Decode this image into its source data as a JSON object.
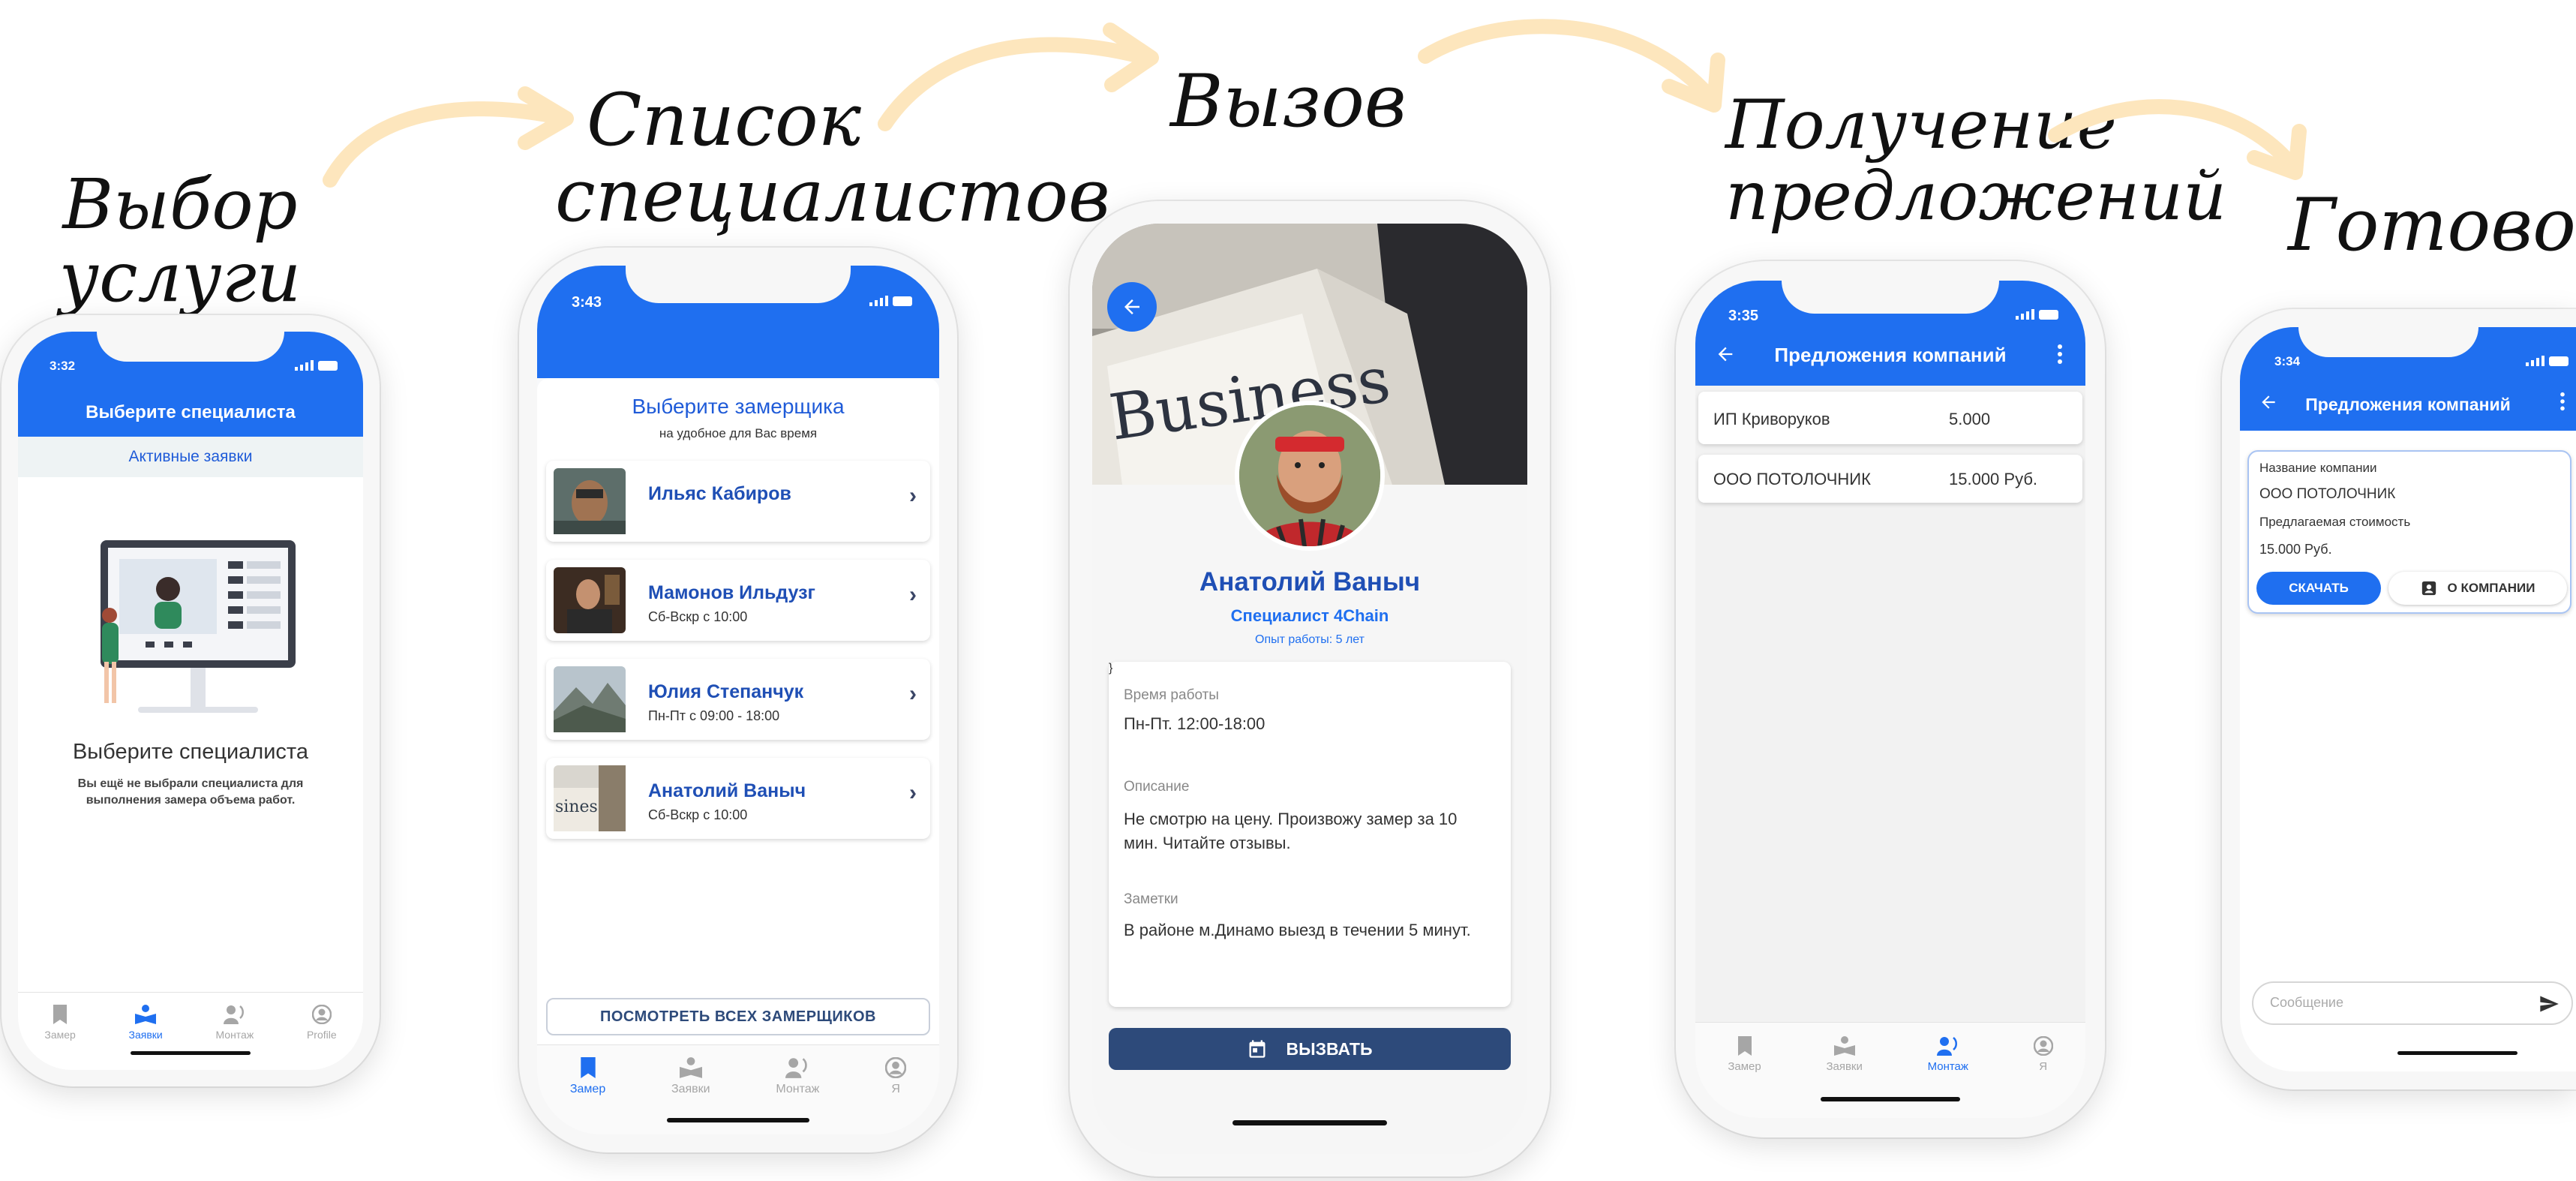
{
  "headings": {
    "step1": "Выбор услуги",
    "step2_line1": "Список",
    "step2_line2": "специалистов",
    "step3": "Вызов",
    "step4_line1": "Получение",
    "step4_line2": "предложений",
    "step5": "Готово!"
  },
  "phone1": {
    "time": "3:32",
    "title": "Выберите специалиста",
    "tab_active_requests": "Активные заявки",
    "empty_title": "Выберите специалиста",
    "empty_text": "Вы ещё не выбрали специалиста для выполнения замера объема работ.",
    "tabs": [
      "Замер",
      "Заявки",
      "Монтаж",
      "Profile"
    ]
  },
  "phone2": {
    "time": "3:43",
    "heading": "Выберите замерщика",
    "subheading": "на удобное для Вас время",
    "specialists": [
      {
        "name": "Ильяс Кабиров",
        "schedule": ""
      },
      {
        "name": "Мамонов Ильдузг",
        "schedule": "Сб-Вскр с 10:00"
      },
      {
        "name": "Юлия Степанчук",
        "schedule": "Пн-Пт с 09:00 - 18:00"
      },
      {
        "name": "Анатолий Ваныч",
        "schedule": "Сб-Вскр с 10:00"
      }
    ],
    "view_all": "ПОСМОТРЕТЬ ВСЕХ ЗАМЕРЩИКОВ",
    "tabs": [
      "Замер",
      "Заявки",
      "Монтаж",
      "Я"
    ]
  },
  "phone3": {
    "cover_text": "Business",
    "name": "Анатолий Ваныч",
    "role": "Специалист 4Chain",
    "experience": "Опыт работы: 5 лет",
    "work_time_label": "Время работы",
    "work_time_value": "Пн-Пт. 12:00-18:00",
    "description_label": "Описание",
    "description_value": "Не смотрю на цену. Произвожу замер за 10 мин. Читайте отзывы.",
    "notes_label": "Заметки",
    "notes_value": "В районе м.Динамо выезд в течении 5 минут.",
    "call_button": "ВЫЗВАТЬ"
  },
  "phone4": {
    "time": "3:35",
    "title": "Предложения компаний",
    "offers": [
      {
        "company": "ИП Криворуков",
        "price": "5.000"
      },
      {
        "company": "ООО ПОТОЛОЧНИК",
        "price": "15.000 Руб."
      }
    ],
    "tabs": [
      "Замер",
      "Заявки",
      "Монтаж",
      "Я"
    ]
  },
  "phone5": {
    "time": "3:34",
    "title": "Предложения компаний",
    "company_label": "Название компании",
    "company_value": "ООО ПОТОЛОЧНИК",
    "price_label": "Предлагаемая стоимость",
    "price_value": "15.000 Руб.",
    "download_button": "СКАЧАТЬ",
    "about_button": "О КОМПАНИИ",
    "message_placeholder": "Сообщение"
  },
  "colors": {
    "brand_blue": "#1f6ff0",
    "dark_navy_button": "#2d4a7a",
    "arrow": "#fde6bd"
  }
}
